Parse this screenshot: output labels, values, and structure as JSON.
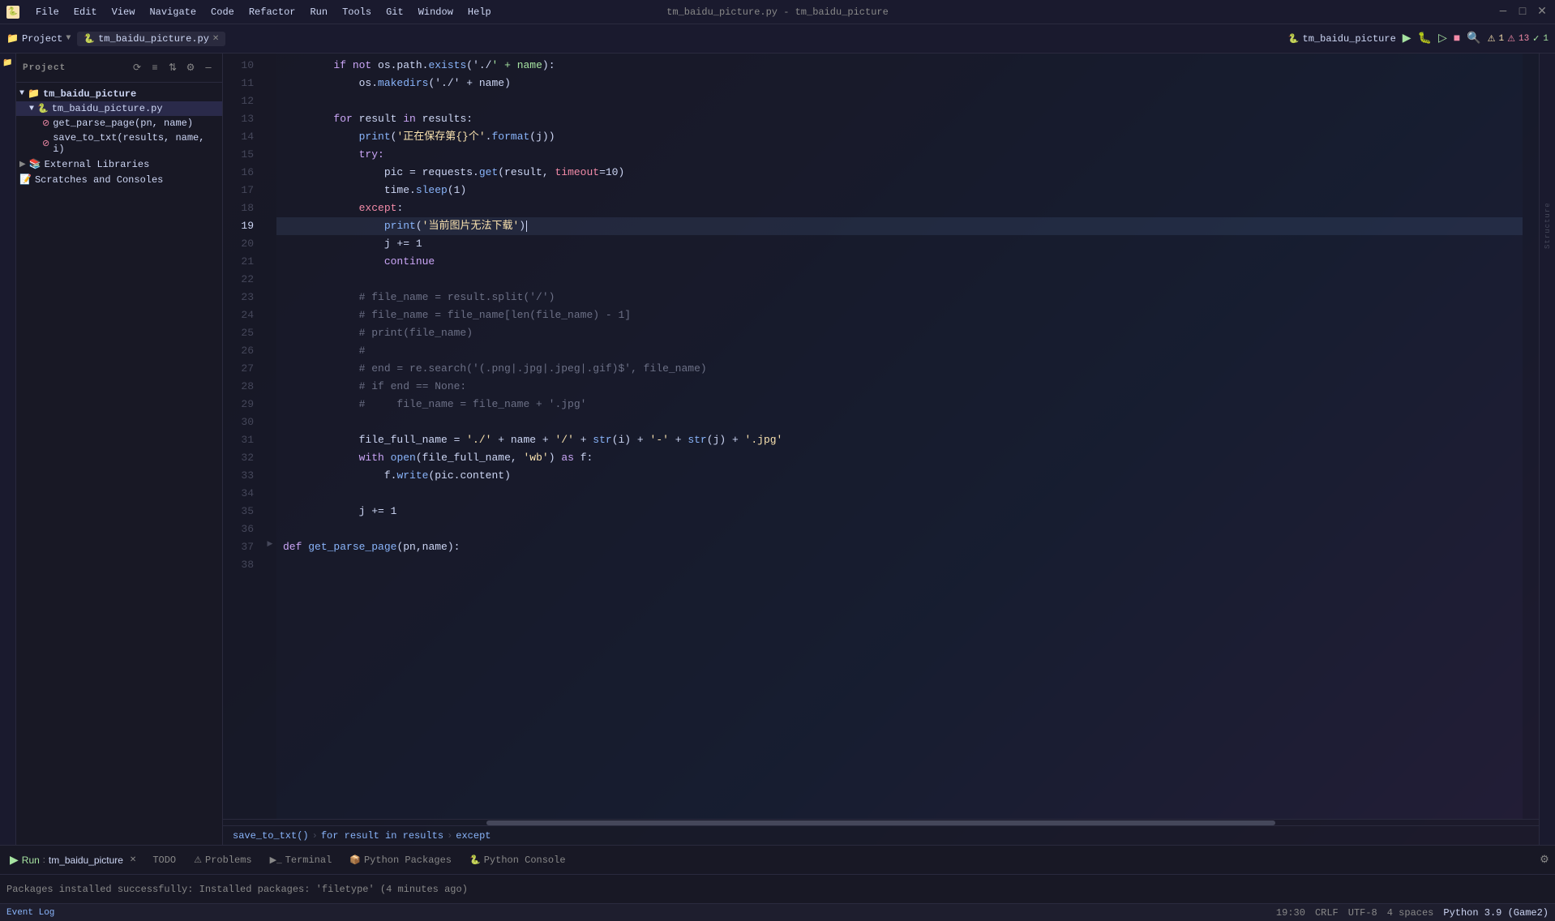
{
  "titlebar": {
    "title": "tm_baidu_picture.py - tm_baidu_picture",
    "menu_items": [
      "File",
      "Edit",
      "View",
      "Navigate",
      "Code",
      "Refactor",
      "Run",
      "Tools",
      "Git",
      "Window",
      "Help"
    ]
  },
  "header": {
    "project_label": "Project",
    "file_tab": "tm_baidu_picture.py",
    "project_icon": "📁",
    "run_config": "tm_baidu_picture",
    "warnings": "⚠ 1",
    "errors": "⚠ 13",
    "checks": "✓ 1"
  },
  "sidebar": {
    "title": "Project",
    "items": [
      {
        "label": "tm_baidu_picture",
        "type": "folder",
        "indent": 0,
        "expanded": true
      },
      {
        "label": "tm_baidu_picture.py",
        "type": "file",
        "indent": 1,
        "selected": true
      },
      {
        "label": "get_parse_page(pn, name)",
        "type": "func",
        "indent": 2,
        "error": true
      },
      {
        "label": "save_to_txt(results, name, i)",
        "type": "func",
        "indent": 2,
        "error": true
      },
      {
        "label": "External Libraries",
        "type": "folder",
        "indent": 0
      },
      {
        "label": "Scratches and Consoles",
        "type": "folder",
        "indent": 0
      }
    ]
  },
  "editor": {
    "filename": "tm_baidu_picture.py",
    "lines": [
      {
        "num": 10,
        "content": "        if not os.path.exists('./' + name):"
      },
      {
        "num": 11,
        "content": "            os.makedirs('./' + name)"
      },
      {
        "num": 12,
        "content": ""
      },
      {
        "num": 13,
        "content": "        for result in results:"
      },
      {
        "num": 14,
        "content": "            print('正在保存第{}个'.format(j))"
      },
      {
        "num": 15,
        "content": "            try:"
      },
      {
        "num": 16,
        "content": "                pic = requests.get(result, timeout=10)"
      },
      {
        "num": 17,
        "content": "                time.sleep(1)"
      },
      {
        "num": 18,
        "content": "            except:"
      },
      {
        "num": 19,
        "content": "                print('当前图片无法下载')"
      },
      {
        "num": 20,
        "content": "                j += 1"
      },
      {
        "num": 21,
        "content": "                continue"
      },
      {
        "num": 22,
        "content": ""
      },
      {
        "num": 23,
        "content": "            # file_name = result.split('/')"
      },
      {
        "num": 24,
        "content": "            # file_name = file_name[len(file_name) - 1]"
      },
      {
        "num": 25,
        "content": "            # print(file_name)"
      },
      {
        "num": 26,
        "content": "            #"
      },
      {
        "num": 27,
        "content": "            # end = re.search('(.png|.jpg|.jpeg|.gif)$', file_name)"
      },
      {
        "num": 28,
        "content": "            # if end == None:"
      },
      {
        "num": 29,
        "content": "            #     file_name = file_name + '.jpg'"
      },
      {
        "num": 30,
        "content": ""
      },
      {
        "num": 31,
        "content": "            file_full_name = './' + name + '/' + str(i) + '-' + str(j) + '.jpg'"
      },
      {
        "num": 32,
        "content": "            with open(file_full_name, 'wb') as f:"
      },
      {
        "num": 33,
        "content": "                f.write(pic.content)"
      },
      {
        "num": 34,
        "content": ""
      },
      {
        "num": 35,
        "content": "            j += 1"
      },
      {
        "num": 36,
        "content": ""
      },
      {
        "num": 37,
        "content": "def get_parse_page(pn,name):"
      },
      {
        "num": 38,
        "content": ""
      }
    ],
    "current_line": 19,
    "cursor_line": 19
  },
  "breadcrumb": {
    "items": [
      "save_to_txt()",
      "for result in results",
      "except"
    ]
  },
  "bottom_tabs": {
    "run": "Run",
    "todo": "TODO",
    "problems": "Problems",
    "terminal": "Terminal",
    "python_packages": "Python Packages",
    "python_console": "Python Console"
  },
  "run_panel": {
    "run_label": "Run:",
    "run_config": "tm_baidu_picture",
    "message": "Packages installed successfully: Installed packages: 'filetype' (4 minutes ago)"
  },
  "status_bar": {
    "line_col": "19:30",
    "encoding": "UTF-8",
    "indent": "4 spaces",
    "crlf": "CRLF",
    "python": "Python 3.9 (Game2)",
    "event_log": "Event Log",
    "warnings_count": "1",
    "errors_count": "13",
    "checks_count": "1"
  }
}
